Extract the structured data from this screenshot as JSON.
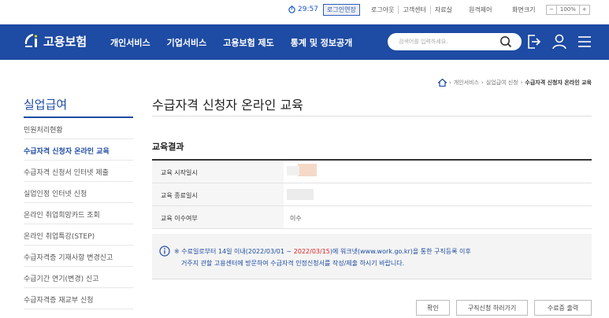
{
  "util": {
    "timer": "29:57",
    "extend_label": "로그인연장",
    "links": [
      "로그아웃",
      "고객센터",
      "자료실"
    ],
    "remote": "원격제어",
    "font_size_label": "화면크기",
    "zoom_minus": "−",
    "zoom_value": "100%",
    "zoom_plus": "+"
  },
  "header": {
    "logo_text": "고용보험",
    "menu": [
      "개인서비스",
      "기업서비스",
      "고용보험 제도",
      "통계 및 정보공개"
    ],
    "search_placeholder": "검색어를 입력하세요."
  },
  "breadcrumb": [
    "개인서비스",
    "실업급여 신청",
    "수급자격 신청자 온라인 교육"
  ],
  "sidebar": {
    "title": "실업급여",
    "items": [
      "민원처리현황",
      "수급자격 신청자 온라인 교육",
      "수급자격 신청서 인터넷 제출",
      "실업인정 인터넷 신청",
      "온라인 취업희망카드 조회",
      "온라인 취업특강(STEP)",
      "수급자격증 기재사항 변경신고",
      "수급기간 연기(변경) 신고",
      "수급자격증 재교부 신청"
    ]
  },
  "main": {
    "title": "수급자격 신청자 온라인 교육",
    "section_title": "교육결과",
    "rows": [
      {
        "label": "교육 시작일시",
        "value": ""
      },
      {
        "label": "교육 종료일시",
        "value": ""
      },
      {
        "label": "교육 이수여부",
        "value": "이수"
      }
    ],
    "notice": {
      "line1_a": "※ 수료일로부터 14일 이내(2022/03/01 ~ ",
      "line1_red": "2022/03/15",
      "line1_b": ")에 워크넷(www.work.go.kr)을 통한 구직등록 이후",
      "line2": "거주지 관할 고용센터에 방문하여 수급자격 인정신청서를 작성/제출 하시기 바랍니다."
    },
    "buttons": [
      "확인",
      "구직신청 하러가기",
      "수료증 출력"
    ]
  },
  "colors": {
    "primary": "#1e4ba3",
    "highlight": "#e02020"
  }
}
